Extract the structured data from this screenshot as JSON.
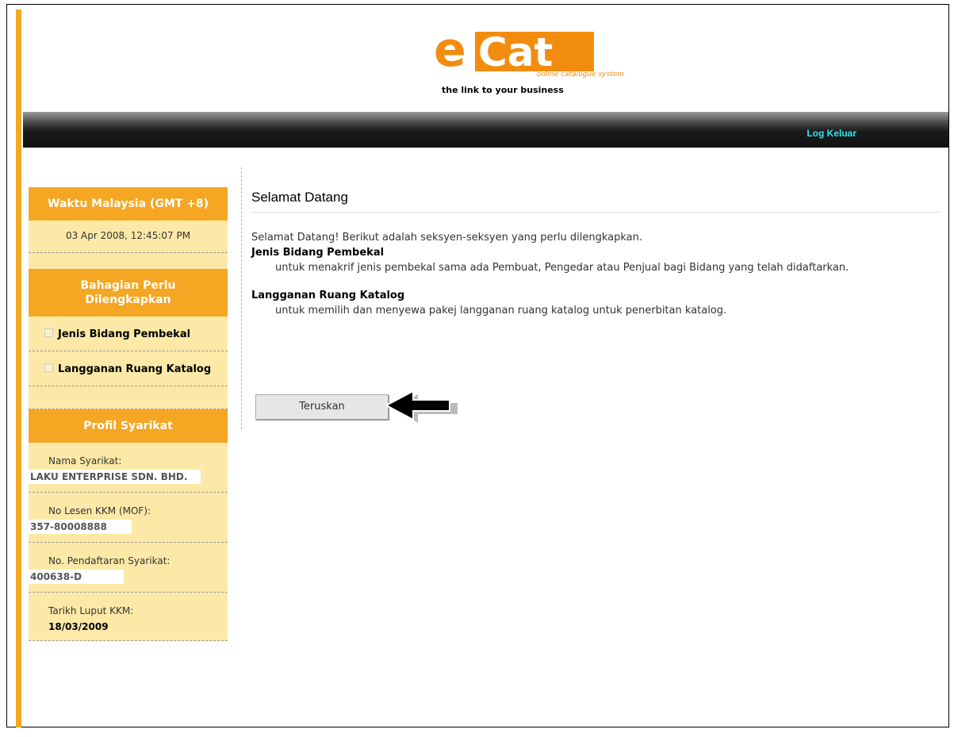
{
  "header": {
    "logo_e": "e",
    "logo_cat": "Cat",
    "logo_sub": "online catalogue system",
    "tagline": "the link to your business"
  },
  "navbar": {
    "logout_label": "Log Keluar"
  },
  "sidebar": {
    "time_heading": "Waktu Malaysia (GMT +8)",
    "clock": "03 Apr 2008, 12:45:07 PM",
    "sections_heading": "Bahagian Perlu Dilengkapkan",
    "sections": [
      {
        "label": "Jenis Bidang Pembekal"
      },
      {
        "label": "Langganan Ruang Katalog"
      }
    ],
    "profile_heading": "Profil Syarikat",
    "profile": [
      {
        "label": "Nama Syarikat:",
        "value": "LAKU ENTERPRISE SDN. BHD."
      },
      {
        "label": "No Lesen KKM (MOF):",
        "value": "357-80008888"
      },
      {
        "label": "No. Pendaftaran Syarikat:",
        "value": "400638-D"
      },
      {
        "label": "Tarikh Luput KKM:",
        "value": "18/03/2009"
      }
    ]
  },
  "main": {
    "title": "Selamat Datang",
    "intro": "Selamat Datang! Berikut adalah seksyen-seksyen yang perlu dilengkapkan.",
    "sections": [
      {
        "title": "Jenis Bidang Pembekal",
        "desc": "untuk menakrif jenis pembekal sama ada Pembuat, Pengedar atau Penjual bagi Bidang yang telah didaftarkan."
      },
      {
        "title": "Langganan Ruang Katalog",
        "desc": "untuk memilih dan menyewa pakej langganan ruang katalog untuk penerbitan katalog."
      }
    ],
    "continue_label": "Teruskan"
  },
  "colors": {
    "accent": "#f5a623",
    "sidebar_bg": "#fde9a7",
    "logout": "#2fe7ef"
  }
}
